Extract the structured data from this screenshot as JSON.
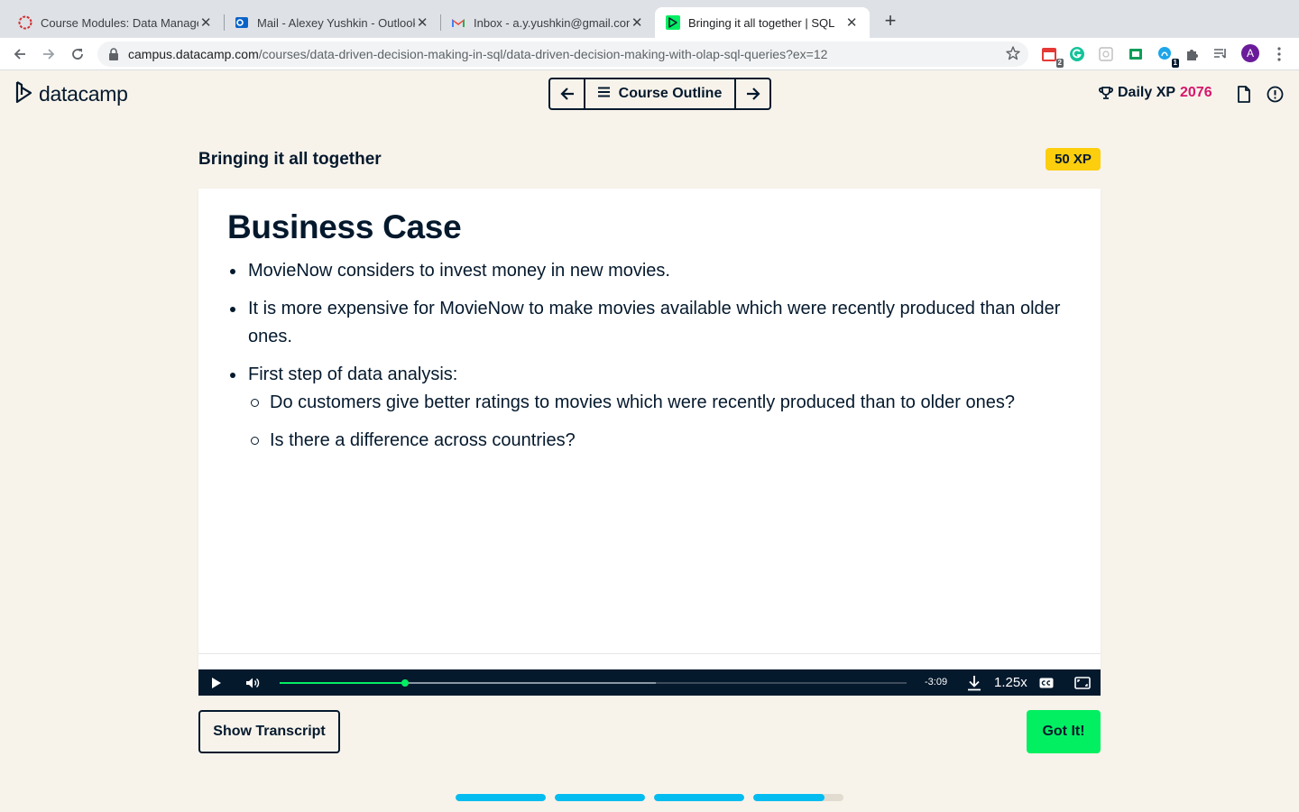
{
  "browser": {
    "tabs": [
      {
        "title": "Course Modules: Data Manage",
        "active": false
      },
      {
        "title": "Mail - Alexey Yushkin - Outlook",
        "active": false
      },
      {
        "title": "Inbox - a.y.yushkin@gmail.com",
        "active": false
      },
      {
        "title": "Bringing it all together | SQL",
        "active": true
      }
    ],
    "url_host": "campus.datacamp.com",
    "url_path": "/courses/data-driven-decision-making-in-sql/data-driven-decision-making-with-olap-sql-queries?ex=12",
    "extensions": [
      {
        "name": "calendar-extension-icon",
        "badge": "2"
      },
      {
        "name": "grammarly-icon",
        "badge": ""
      },
      {
        "name": "extension-icon",
        "badge": ""
      },
      {
        "name": "sheets-extension-icon",
        "badge": ""
      },
      {
        "name": "extension-icon",
        "badge": "1"
      },
      {
        "name": "puzzle-icon",
        "badge": ""
      },
      {
        "name": "reading-list-icon",
        "badge": ""
      }
    ],
    "avatar_letter": "A"
  },
  "header": {
    "logo_text": "datacamp",
    "course_outline_label": "Course Outline",
    "daily_xp_label": "Daily XP",
    "daily_xp_value": "2076"
  },
  "exercise": {
    "title": "Bringing it all together",
    "xp_badge": "50 XP"
  },
  "slide": {
    "heading": "Business Case",
    "bullets": [
      "MovieNow considers to invest money in new movies.",
      "It is more expensive for MovieNow to make movies available which were recently produced than older ones.",
      "First step of data analysis:"
    ],
    "sub_bullets": [
      "Do customers give better ratings to movies which were recently produced than to older ones?",
      "Is there a difference across countries?"
    ]
  },
  "video": {
    "time_remaining": "-3:09",
    "speed": "1.25x",
    "played_fraction": 0.2,
    "buffered_fraction": 0.6
  },
  "actions": {
    "show_transcript_label": "Show Transcript",
    "got_it_label": "Got It!"
  },
  "progress_steps": [
    1.0,
    1.0,
    1.0,
    0.79
  ],
  "colors": {
    "brand_green": "#03ef62",
    "navy": "#05192d",
    "xp_pink": "#d6166a",
    "xp_badge": "#fcce0d",
    "step_blue": "#05bcf0"
  }
}
